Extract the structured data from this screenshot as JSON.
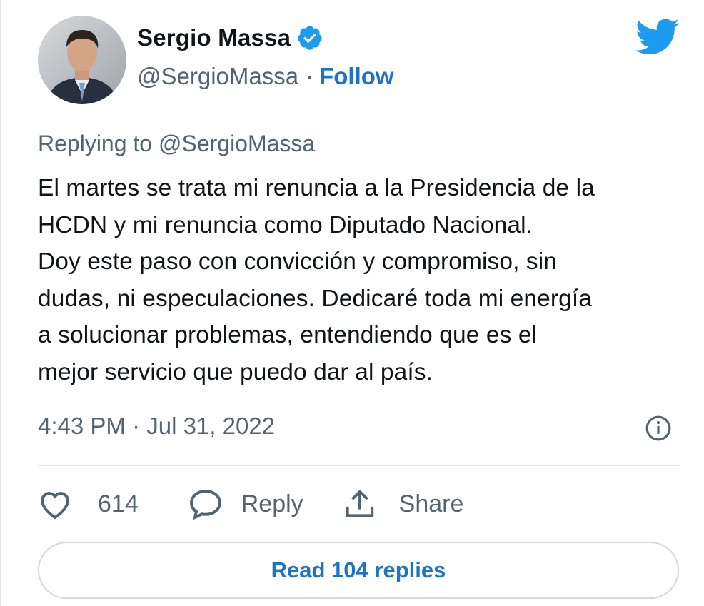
{
  "author": {
    "name": "Sergio Massa",
    "handle": "@SergioMassa",
    "separator": "·",
    "follow_label": "Follow",
    "verified": true,
    "avatar_icon": "profile-photo"
  },
  "brand": {
    "icon": "twitter-bird-icon",
    "color": "#1d9bf0"
  },
  "tweet": {
    "reply_to": "Replying to @SergioMassa",
    "text": "El martes se trata mi renuncia a la Presidencia de la\nHCDN y mi renuncia como Diputado Nacional.\nDoy este paso con convicción y compromiso, sin\ndudas, ni especulaciones. Dedicaré toda mi energía\na solucionar problemas, entendiendo que es el\nmejor servicio que puedo dar al país.",
    "timestamp": "4:43 PM · Jul 31, 2022"
  },
  "actions": {
    "likes_count": "614",
    "reply_label": "Reply",
    "share_label": "Share"
  },
  "read_replies_label": "Read 104 replies",
  "colors": {
    "link": "#1d73c9",
    "muted": "#536471",
    "text": "#0f1419"
  }
}
